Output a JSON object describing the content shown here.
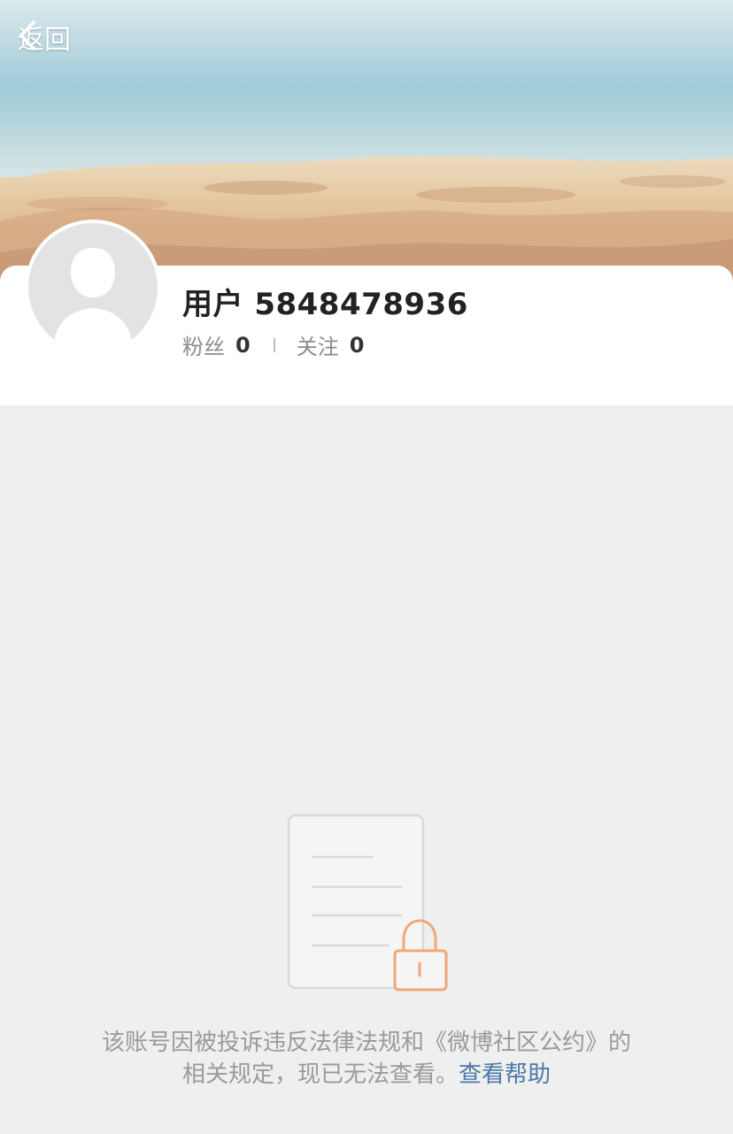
{
  "nav": {
    "back_label": "返回"
  },
  "profile": {
    "name": "用户 5848478936",
    "followers_label": "粉丝",
    "followers_count": "0",
    "following_label": "关注",
    "following_count": "0"
  },
  "notice": {
    "line1": "该账号因被投诉违反法律法规和《微博社区公约》的",
    "line2_text": "相关规定，现已无法查看。",
    "help_link": "查看帮助"
  },
  "icons": {
    "back": "chevron-left-icon",
    "avatar": "default-avatar-icon",
    "locked_document": "locked-document-icon"
  },
  "colors": {
    "link": "#4d78a8",
    "lock_orange": "#f0a878",
    "background": "#efefef"
  }
}
